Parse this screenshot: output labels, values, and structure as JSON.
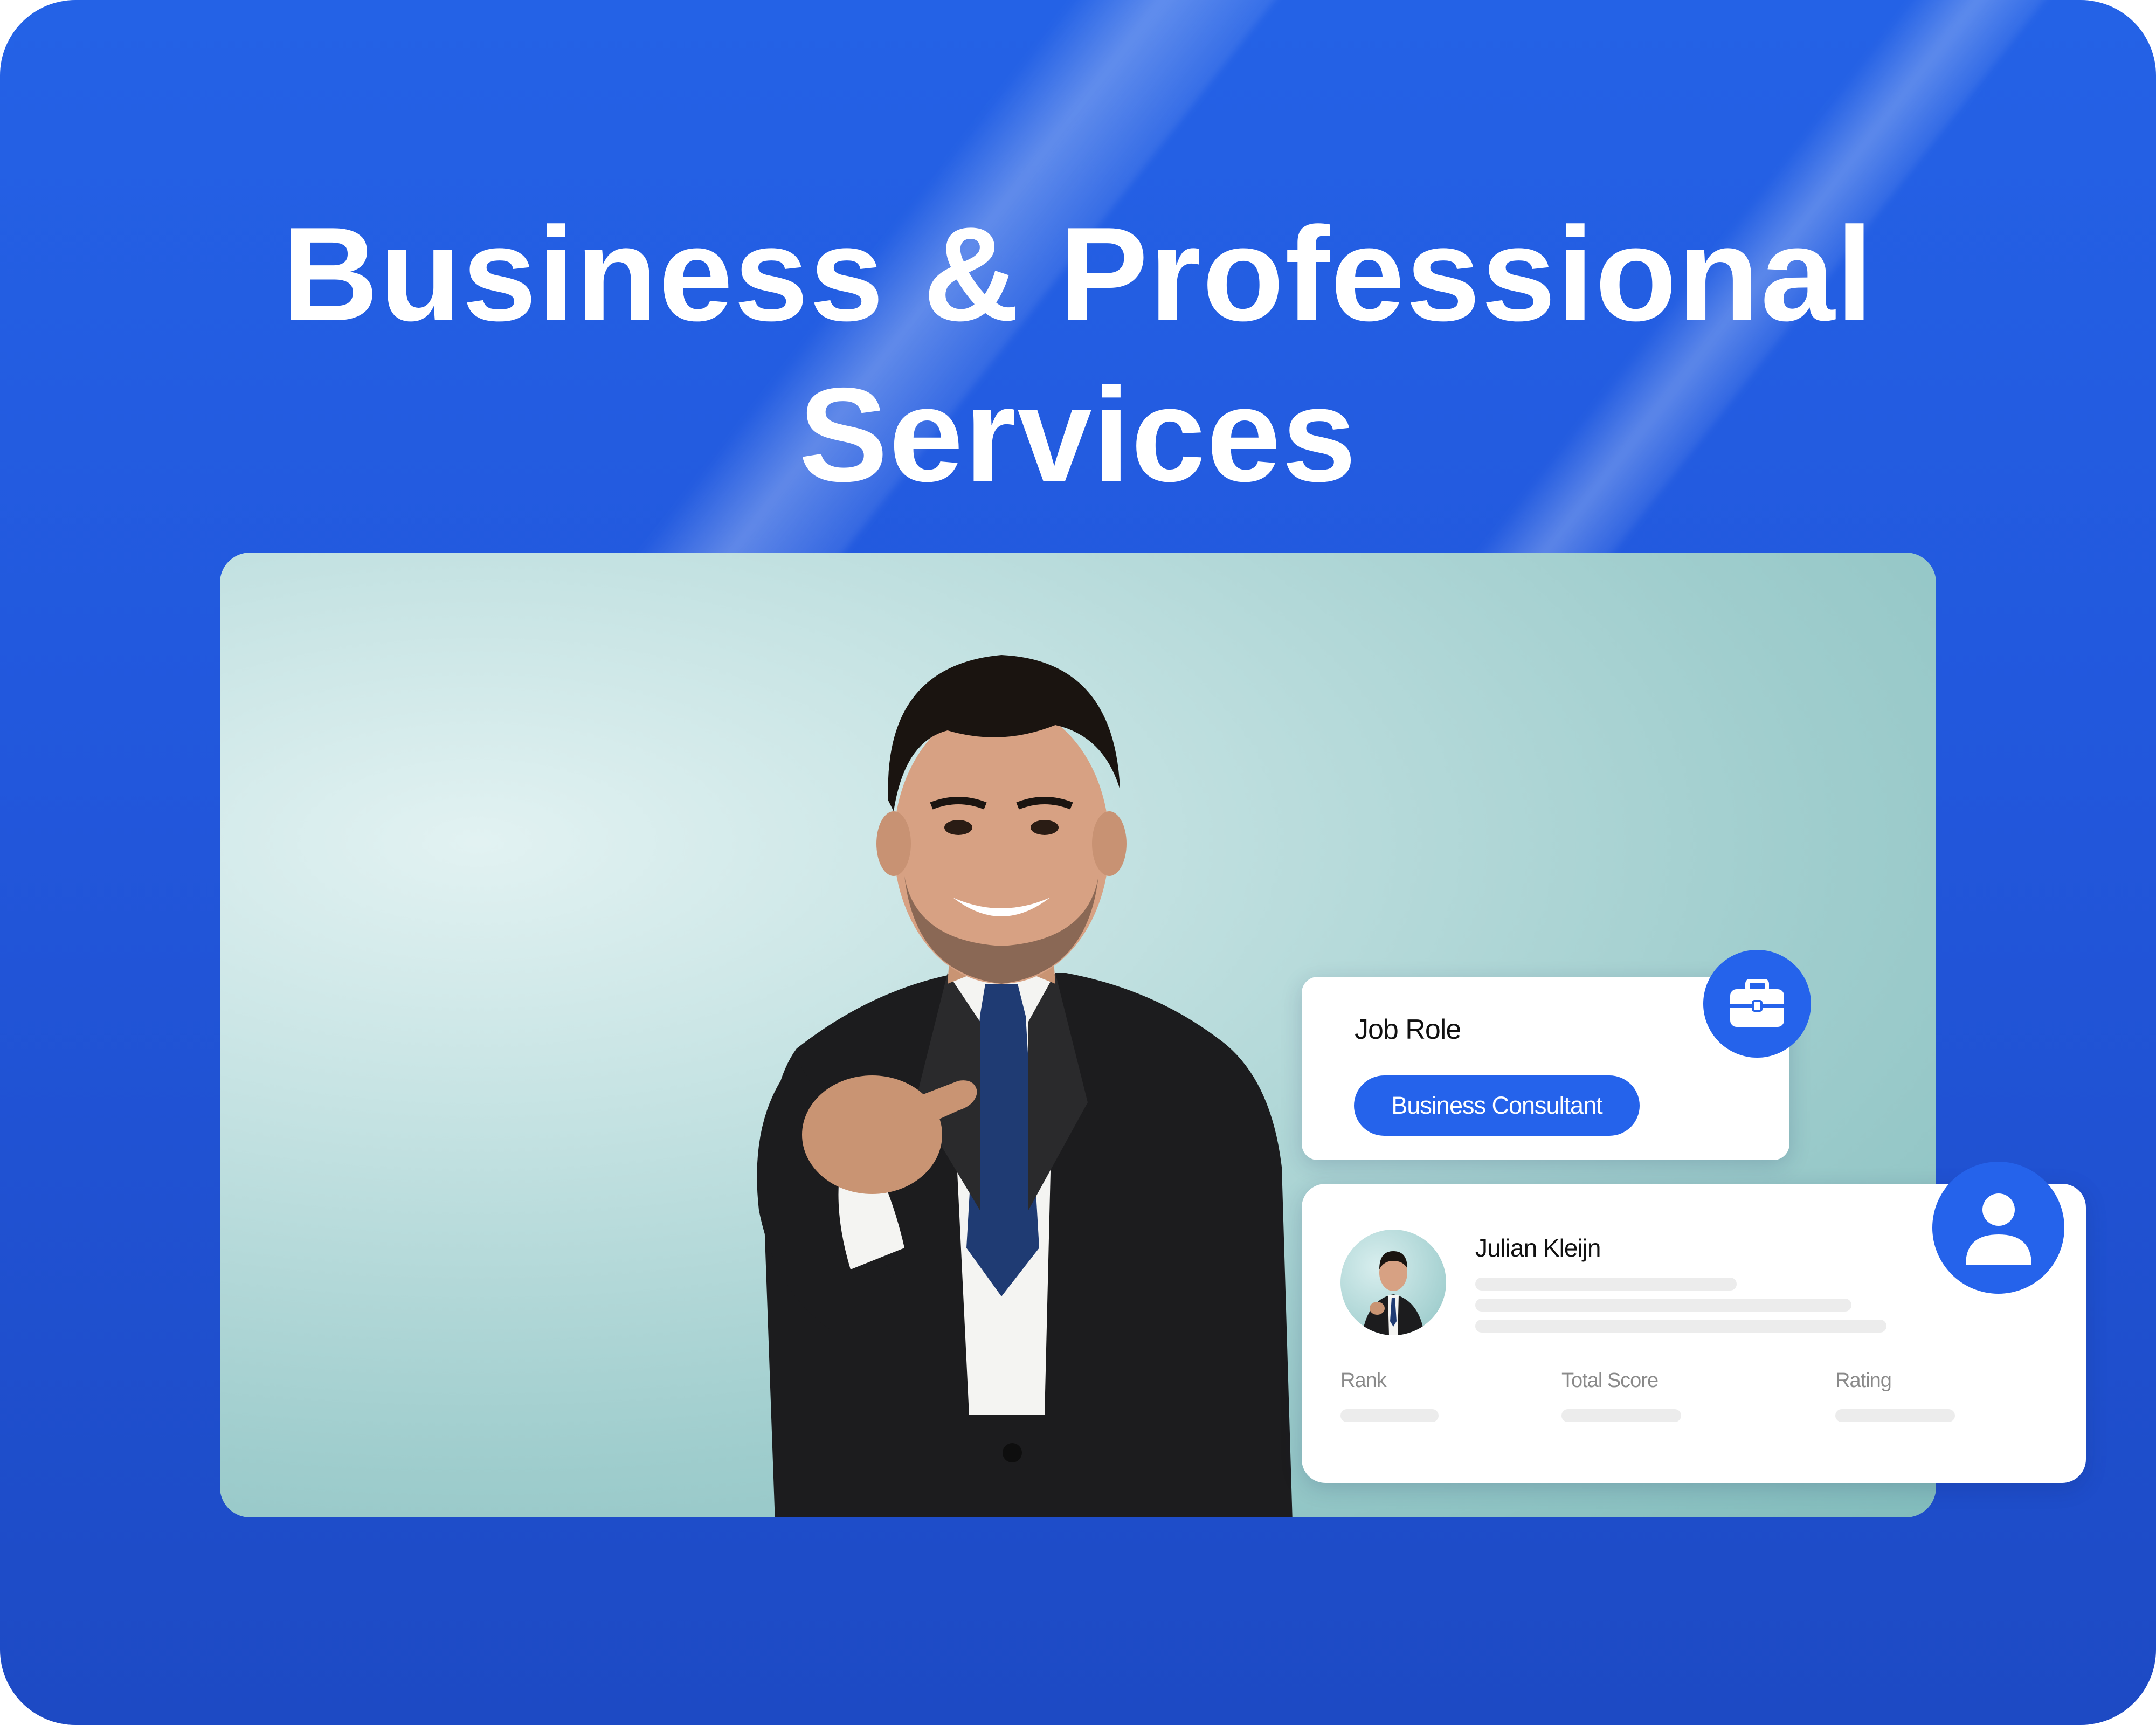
{
  "page": {
    "title": "Business & Professional Services"
  },
  "job_card": {
    "label": "Job Role",
    "role": "Business Consultant"
  },
  "profile_card": {
    "name": "Julian Kleijn",
    "stats": [
      {
        "label": "Rank"
      },
      {
        "label": "Total Score"
      },
      {
        "label": "Rating"
      }
    ]
  },
  "colors": {
    "background": "#2259dc",
    "accent": "#2563eb",
    "card": "#ffffff",
    "skeleton": "#ececec"
  },
  "icons": {
    "job_badge": "briefcase-icon",
    "profile_badge": "user-icon"
  }
}
